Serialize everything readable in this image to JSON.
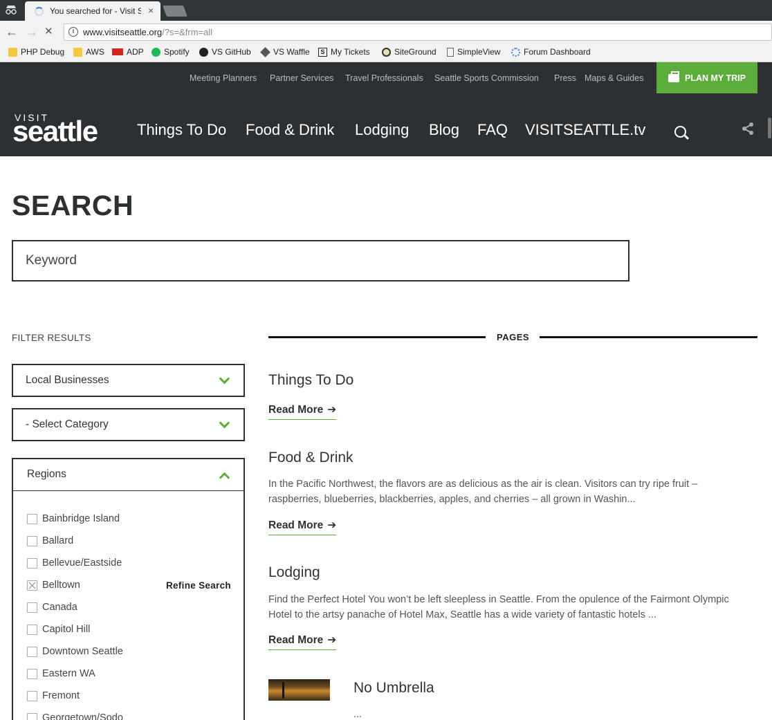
{
  "browser": {
    "tab_title": "You searched for - Visit S",
    "tab_close": "×",
    "url_host": "www.visitseattle.org",
    "url_rest": "/?s=&frm=all",
    "back": "←",
    "forward": "→",
    "stop": "✕"
  },
  "bookmarks": [
    {
      "label": "PHP Debug",
      "icon": "folder-icon"
    },
    {
      "label": "AWS",
      "icon": "folder-icon"
    },
    {
      "label": "ADP",
      "icon": "adp-icon"
    },
    {
      "label": "Spotify",
      "icon": "spotify-icon"
    },
    {
      "label": "VS GitHub",
      "icon": "github-icon"
    },
    {
      "label": "VS Waffle",
      "icon": "waffle-icon"
    },
    {
      "label": "My Tickets",
      "icon": "tickets-icon"
    },
    {
      "label": "SiteGround",
      "icon": "siteground-icon"
    },
    {
      "label": "SimpleView",
      "icon": "page-icon"
    },
    {
      "label": "Forum Dashboard",
      "icon": "forum-icon"
    }
  ],
  "header": {
    "utility_links": [
      "Meeting Planners",
      "Partner Services",
      "Travel Professionals",
      "Seattle Sports Commission",
      "Press",
      "Maps & Guides"
    ],
    "plan_button": "PLAN MY TRIP",
    "logo_top": "VISIT",
    "logo_bottom": "seattle",
    "nav": [
      "Things To Do",
      "Food & Drink",
      "Lodging",
      "Blog",
      "FAQ",
      "VISITSEATTLE.tv"
    ],
    "accent_color": "#5cad3c",
    "header_bg": "#2d3033"
  },
  "search": {
    "title": "SEARCH",
    "keyword_placeholder": "Keyword"
  },
  "filters": {
    "label": "FILTER RESULTS",
    "type_select": "Local Businesses",
    "category_select": "- Select Category",
    "regions_label": "Regions",
    "refine_label": "Refine Search",
    "regions": [
      {
        "label": "Bainbridge Island",
        "checked": false
      },
      {
        "label": "Ballard",
        "checked": false
      },
      {
        "label": "Bellevue/Eastside",
        "checked": false
      },
      {
        "label": "Belltown",
        "checked": true
      },
      {
        "label": "Canada",
        "checked": false
      },
      {
        "label": "Capitol Hill",
        "checked": false
      },
      {
        "label": "Downtown Seattle",
        "checked": false
      },
      {
        "label": "Eastern WA",
        "checked": false
      },
      {
        "label": "Fremont",
        "checked": false
      },
      {
        "label": "Georgetown/Sodo",
        "checked": false
      }
    ]
  },
  "results": {
    "section_label": "PAGES",
    "read_more": "Read More",
    "arrow": "➔",
    "items": [
      {
        "title": "Things To Do",
        "excerpt": ""
      },
      {
        "title": "Food & Drink",
        "excerpt": "In the Pacific Northwest, the flavors are as delicious as the air is clean. Visitors can try ripe fruit – raspberries, blueberries, blackberries, apples, and cherries – all grown in Washin..."
      },
      {
        "title": "Lodging",
        "excerpt": "Find the Perfect Hotel You won’t be left sleepless in Seattle. From the opulence of the Fairmont Olympic Hotel to the artsy panache of Hotel Max, Seattle has a wide variety of fantastic hotels ..."
      },
      {
        "title": "No Umbrella",
        "excerpt": "..."
      }
    ]
  }
}
